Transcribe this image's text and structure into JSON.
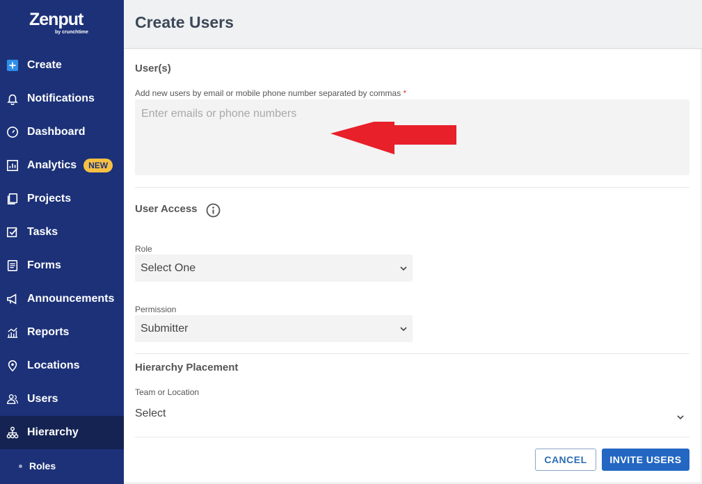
{
  "brand": {
    "name": "Zenput",
    "sub": "by crunchtime"
  },
  "sidebar": {
    "items": [
      {
        "label": "Create",
        "icon": "plus-icon"
      },
      {
        "label": "Notifications",
        "icon": "bell-icon"
      },
      {
        "label": "Dashboard",
        "icon": "gauge-icon"
      },
      {
        "label": "Analytics",
        "icon": "chart-icon",
        "badge": "NEW"
      },
      {
        "label": "Projects",
        "icon": "projects-icon"
      },
      {
        "label": "Tasks",
        "icon": "checkbox-icon"
      },
      {
        "label": "Forms",
        "icon": "form-icon"
      },
      {
        "label": "Announcements",
        "icon": "megaphone-icon"
      },
      {
        "label": "Reports",
        "icon": "reports-icon"
      },
      {
        "label": "Locations",
        "icon": "location-pin-icon"
      },
      {
        "label": "Users",
        "icon": "users-icon"
      },
      {
        "label": "Hierarchy",
        "icon": "hierarchy-icon"
      }
    ],
    "subitems": [
      {
        "label": "Roles"
      }
    ],
    "active": "Hierarchy",
    "colors": {
      "bg": "#1c3178",
      "active_bg": "#142352",
      "badge": "#f5c044"
    }
  },
  "page": {
    "title": "Create Users"
  },
  "users_section": {
    "title": "User(s)",
    "field_label": "Add new users by email or mobile phone number separated by commas",
    "required_mark": "*",
    "placeholder": "Enter emails or phone numbers"
  },
  "access_section": {
    "title": "User Access",
    "role_label": "Role",
    "role_value": "Select One",
    "permission_label": "Permission",
    "permission_value": "Submitter"
  },
  "hierarchy_section": {
    "title": "Hierarchy Placement",
    "team_label": "Team or Location",
    "team_value": "Select"
  },
  "actions": {
    "cancel": "CANCEL",
    "invite": "INVITE USERS"
  },
  "annotation": {
    "arrow_color": "#e8202a"
  }
}
